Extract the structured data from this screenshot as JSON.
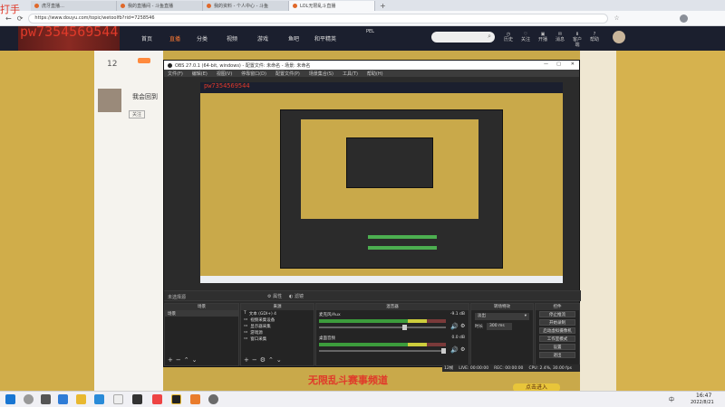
{
  "browser": {
    "tabs": [
      "虎牙直播…",
      "我的直播间 - 斗鱼直播",
      "我的资料 - 个人中心 - 斗鱼",
      "LOL无限乱斗直播"
    ],
    "url": "https://www.douyu.com/topic/wetoolfb?rid=7258546"
  },
  "site_nav": {
    "links": [
      "首页",
      "直播",
      "分类",
      "视频",
      "游戏",
      "鱼吧",
      "和平精英"
    ],
    "event": "PEL",
    "icons": [
      "历史",
      "关注",
      "开播",
      "消息",
      "客户端",
      "帮助"
    ]
  },
  "left_panel": {
    "count": "12",
    "streamer": "我会回到",
    "button": "关注"
  },
  "watermark": {
    "line1": "打手",
    "id": "pw7354569544",
    "accent": "#e03a2a"
  },
  "obs": {
    "title": "OBS 27.0.1 (64-bit, windows) - 配置文件: 未命名 - 场景: 未命名",
    "menu": [
      "文件(F)",
      "编辑(E)",
      "视图(V)",
      "停靠窗口(D)",
      "配置文件(P)",
      "场景集合(S)",
      "工具(T)",
      "帮助(H)"
    ],
    "no_source": "未选择源",
    "props_label": "属性",
    "filters_label": "滤镜",
    "scenes_header": "场景",
    "scene_item": "场景",
    "sources_header": "来源",
    "sources": [
      "文本 (GDI+) 4",
      "视频采集设备",
      "显示器采集",
      "游戏源",
      "窗口采集"
    ],
    "mixer_header": "混音器",
    "mixer": [
      {
        "name": "麦克风/Aux",
        "db": "-9.1 dB"
      },
      {
        "name": "桌面音频",
        "db": "0.0 dB"
      }
    ],
    "transition_header": "转场特效",
    "transition_value": "淡出",
    "duration_label": "时长",
    "duration_value": "300 ms",
    "controls_header": "控件",
    "controls": [
      "停止推流",
      "开始录制",
      "启动虚拟摄像机",
      "工作室模式",
      "设置",
      "退出"
    ],
    "status": {
      "live": "LIVE: 00:00:00",
      "rec": "REC: 00:00:00",
      "cpu": "CPU: 2.4%, 30.00 fps",
      "dropped": "12帧"
    }
  },
  "page_banner": "无限乱斗赛事频道",
  "enter_button": "点击进入",
  "taskbar": {
    "time": "16:47",
    "date": "2022/8/21",
    "tray_text": "中"
  }
}
